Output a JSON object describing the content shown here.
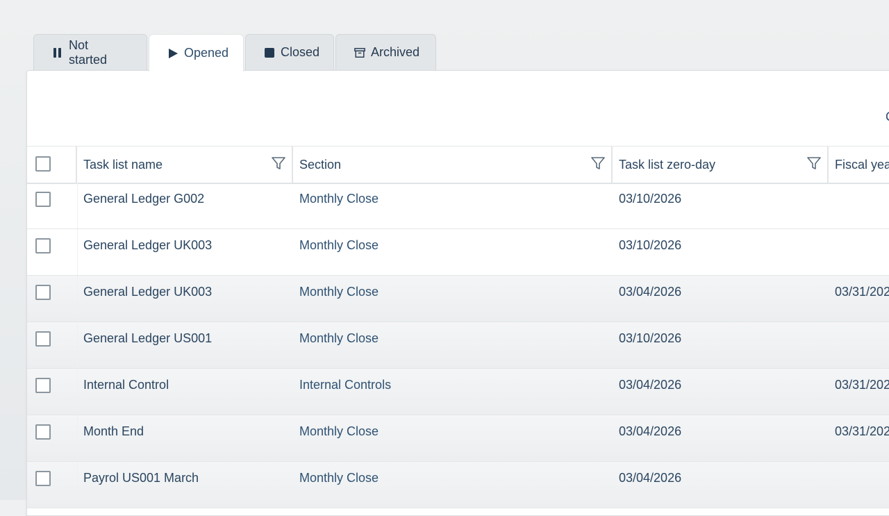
{
  "tabs": [
    {
      "label": "Not started",
      "icon": "pause-icon"
    },
    {
      "label": "Opened",
      "icon": "play-icon"
    },
    {
      "label": "Closed",
      "icon": "stop-icon"
    },
    {
      "label": "Archived",
      "icon": "archive-icon"
    }
  ],
  "toolbar": {
    "edge_text": "C"
  },
  "table": {
    "columns": [
      "Task list name",
      "Section",
      "Task list zero-day",
      "Fiscal yea"
    ],
    "rows": [
      {
        "name": "General Ledger G002",
        "section": "Monthly Close",
        "zero_day": "03/10/2026",
        "fiscal": ""
      },
      {
        "name": "General Ledger UK003",
        "section": "Monthly Close",
        "zero_day": "03/10/2026",
        "fiscal": ""
      },
      {
        "name": "General Ledger UK003",
        "section": "Monthly Close",
        "zero_day": "03/04/2026",
        "fiscal": "03/31/202"
      },
      {
        "name": "General Ledger US001",
        "section": "Monthly Close",
        "zero_day": "03/10/2026",
        "fiscal": ""
      },
      {
        "name": "Internal Control",
        "section": "Internal Controls",
        "zero_day": "03/04/2026",
        "fiscal": "03/31/202"
      },
      {
        "name": "Month End",
        "section": "Monthly Close",
        "zero_day": "03/04/2026",
        "fiscal": "03/31/202"
      },
      {
        "name": "Payrol US001 March",
        "section": "Monthly Close",
        "zero_day": "03/04/2026",
        "fiscal": ""
      }
    ]
  }
}
